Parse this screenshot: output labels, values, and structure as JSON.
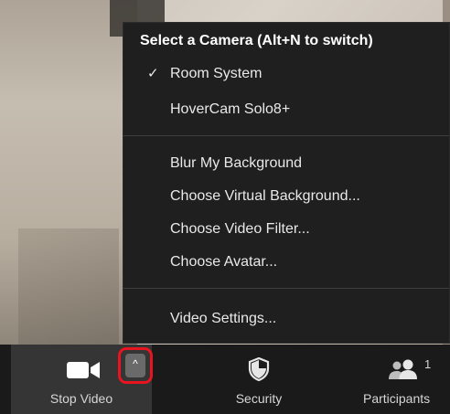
{
  "camera_menu": {
    "title": "Select a Camera (Alt+N to switch)",
    "cameras": [
      {
        "label": "Room System",
        "selected": true,
        "check": "✓"
      },
      {
        "label": "HoverCam Solo8+",
        "selected": false
      }
    ],
    "options": [
      {
        "label": "Blur My Background"
      },
      {
        "label": "Choose Virtual Background..."
      },
      {
        "label": "Choose Video Filter..."
      },
      {
        "label": "Choose Avatar..."
      }
    ],
    "settings": {
      "label": "Video Settings..."
    }
  },
  "toolbar": {
    "stop_video": {
      "label": "Stop Video",
      "icon": "video-camera-icon"
    },
    "video_options_arrow": {
      "glyph": "^",
      "icon": "chevron-up-icon",
      "highlight_color": "#e8141f"
    },
    "security": {
      "label": "Security",
      "icon": "shield-icon"
    },
    "participants": {
      "label": "Participants",
      "count": "1",
      "icon": "people-icon"
    }
  }
}
